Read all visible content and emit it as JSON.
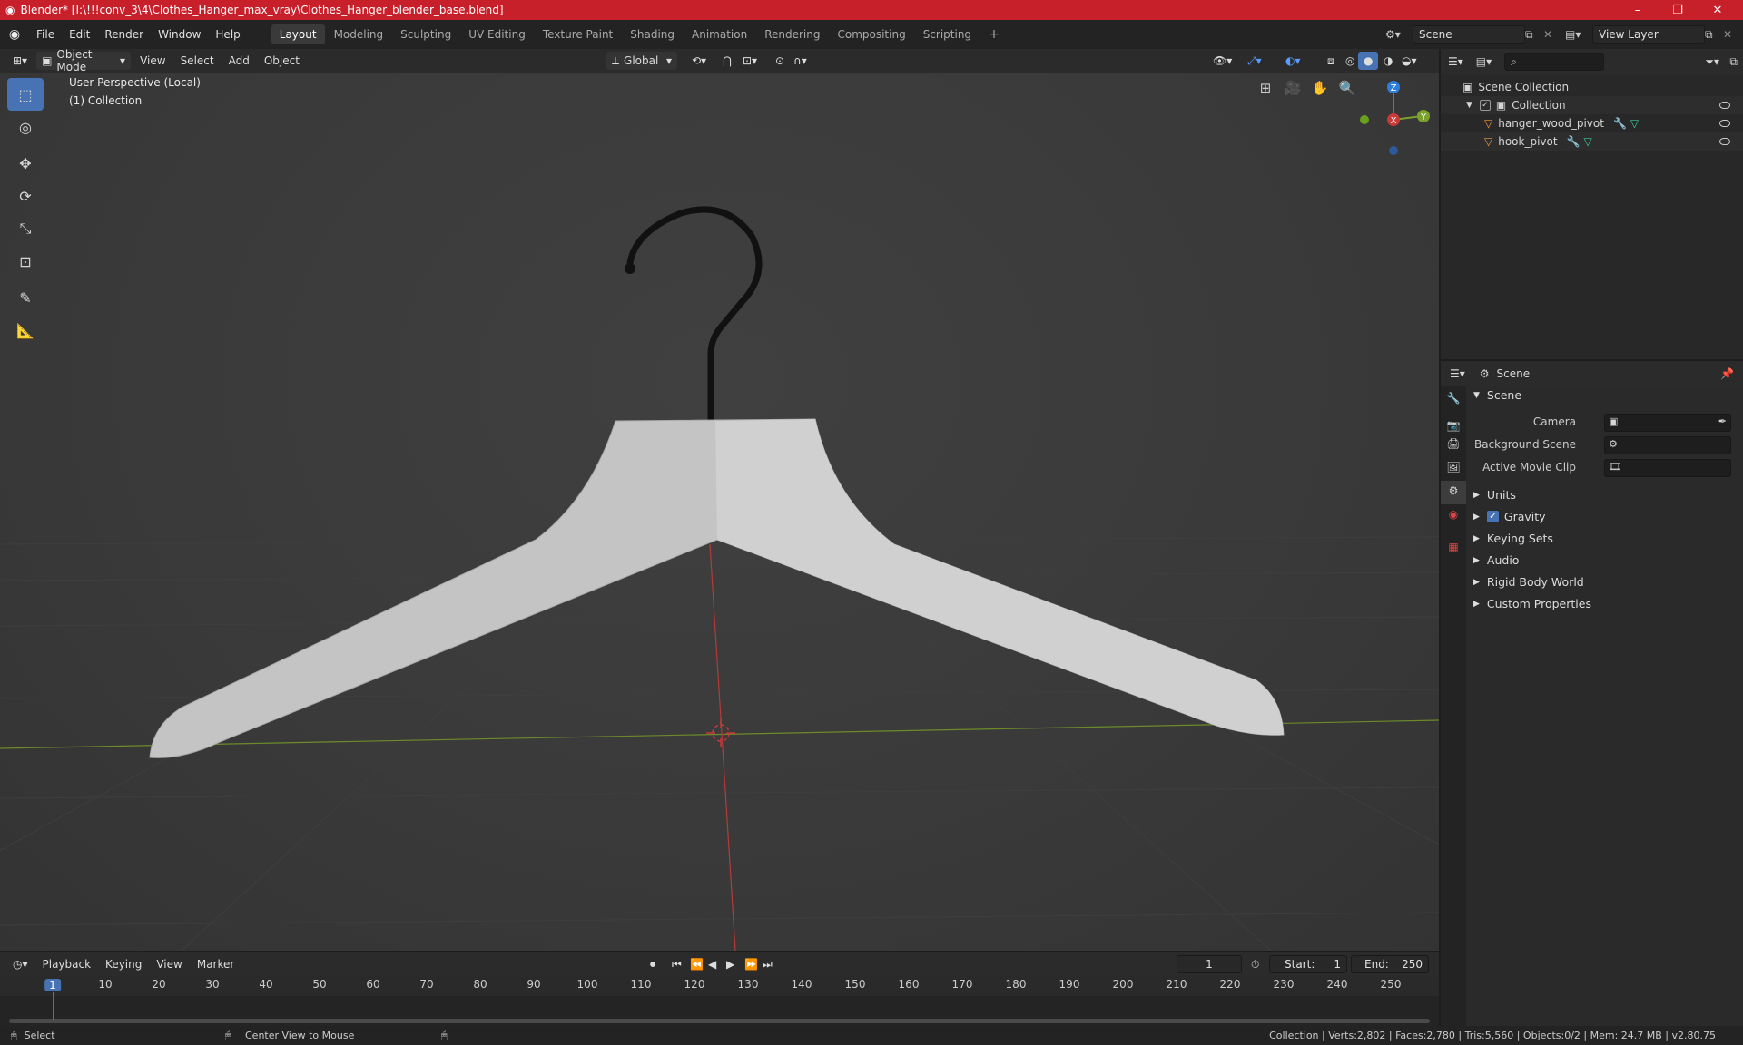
{
  "window": {
    "title": "Blender* [I:\\!!!conv_3\\4\\Clothes_Hanger_max_vray\\Clothes_Hanger_blender_base.blend]",
    "minimize": "–",
    "maximize": "❐",
    "close": "✕"
  },
  "menus": [
    "File",
    "Edit",
    "Render",
    "Window",
    "Help"
  ],
  "workspaces": [
    "Layout",
    "Modeling",
    "Sculpting",
    "UV Editing",
    "Texture Paint",
    "Shading",
    "Animation",
    "Rendering",
    "Compositing",
    "Scripting"
  ],
  "workspace_add": "+",
  "scene_name": "Scene",
  "view_layer": "View Layer",
  "viewport": {
    "mode": "Object Mode",
    "menus": [
      "View",
      "Select",
      "Add",
      "Object"
    ],
    "transform_orientation": "Global",
    "overlay_line1": "User Perspective (Local)",
    "overlay_line2": "(1) Collection",
    "gizmo": {
      "z": "Z",
      "x": "X",
      "y": "Y"
    }
  },
  "outliner": {
    "search_placeholder": "",
    "root": "Scene Collection",
    "collection": "Collection",
    "objects": [
      "hanger_wood_pivot",
      "hook_pivot"
    ]
  },
  "properties": {
    "context": "Scene",
    "panel": "Scene",
    "fields": [
      {
        "label": "Camera"
      },
      {
        "label": "Background Scene"
      },
      {
        "label": "Active Movie Clip"
      }
    ],
    "sections": [
      "Units",
      "Gravity",
      "Keying Sets",
      "Audio",
      "Rigid Body World",
      "Custom Properties"
    ],
    "gravity_checked": true
  },
  "timeline": {
    "menus": [
      "Playback",
      "Keying",
      "View",
      "Marker"
    ],
    "current_frame": "1",
    "start_label": "Start:",
    "start": "1",
    "end_label": "End:",
    "end": "250",
    "ticks": [
      "1",
      "10",
      "20",
      "30",
      "40",
      "50",
      "60",
      "70",
      "80",
      "90",
      "100",
      "110",
      "120",
      "130",
      "140",
      "150",
      "160",
      "170",
      "180",
      "190",
      "200",
      "210",
      "220",
      "230",
      "240",
      "250"
    ]
  },
  "status": {
    "left": "Select",
    "middle": "Center View to Mouse",
    "right": "Collection | Verts:2,802 | Faces:2,780 | Tris:5,560 | Objects:0/2 | Mem: 24.7 MB | v2.80.75"
  },
  "colors": {
    "accent": "#4772b3",
    "titlebar": "#c8202a",
    "axis_x": "#c83a3a",
    "axis_y": "#7aa12d",
    "axis_z": "#2e7ddb"
  }
}
